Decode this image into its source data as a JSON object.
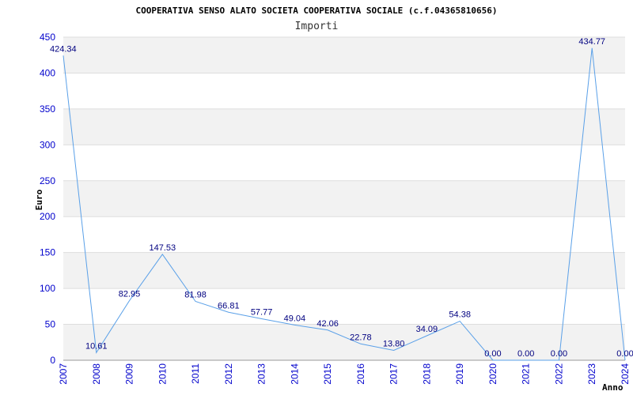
{
  "chart_data": {
    "type": "line",
    "title": "COOPERATIVA SENSO ALATO SOCIETA COOPERATIVA SOCIALE (c.f.04365810656)",
    "subtitle": "Importi",
    "xlabel": "Anno",
    "ylabel": "Euro",
    "ylim": [
      0,
      450
    ],
    "yticks": [
      "0",
      "50",
      "100",
      "150",
      "200",
      "250",
      "300",
      "350",
      "400",
      "450"
    ],
    "grid": true,
    "categories": [
      "2007",
      "2008",
      "2009",
      "2010",
      "2011",
      "2012",
      "2013",
      "2014",
      "2015",
      "2016",
      "2017",
      "2018",
      "2019",
      "2020",
      "2021",
      "2022",
      "2023",
      "2024"
    ],
    "values": [
      424.34,
      10.61,
      82.95,
      147.53,
      81.98,
      66.81,
      57.77,
      49.04,
      42.06,
      22.78,
      13.8,
      34.09,
      54.38,
      0.0,
      0.0,
      0.0,
      434.77,
      0.0
    ],
    "data_labels": [
      "424.34",
      "10.61",
      "82.95",
      "147.53",
      "81.98",
      "66.81",
      "57.77",
      "49.04",
      "42.06",
      "22.78",
      "13.80",
      "34.09",
      "54.38",
      "0.00",
      "0.00",
      "0.00",
      "434.77",
      "0.00"
    ],
    "colors": {
      "line": "#5aa0e8",
      "band": "#f2f2f2",
      "grid": "#dddddd",
      "tick_text": "#0000cc",
      "data_label": "#000080"
    }
  }
}
